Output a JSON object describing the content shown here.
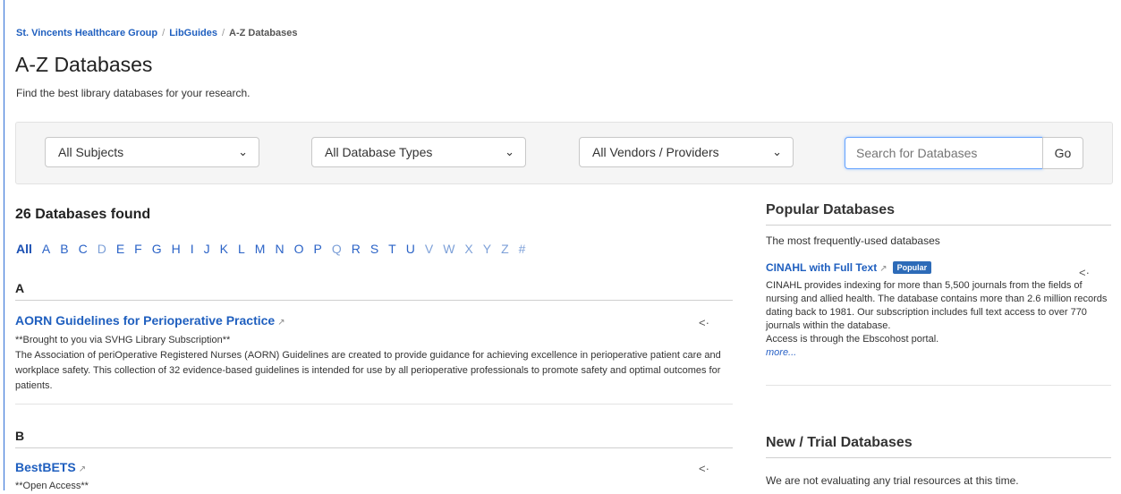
{
  "breadcrumb": {
    "org": "St. Vincents Healthcare Group",
    "libguides": "LibGuides",
    "current": "A-Z Databases",
    "separator": "/"
  },
  "page": {
    "title": "A-Z Databases",
    "subtitle": "Find the best library databases for your research."
  },
  "filters": {
    "subjects": "All Subjects",
    "types": "All Database Types",
    "vendors": "All Vendors / Providers",
    "search_placeholder": "Search for Databases",
    "go_label": "Go"
  },
  "results": {
    "found": "26 Databases found",
    "letters": [
      "All",
      "A",
      "B",
      "C",
      "D",
      "E",
      "F",
      "G",
      "H",
      "I",
      "J",
      "K",
      "L",
      "M",
      "N",
      "O",
      "P",
      "Q",
      "R",
      "S",
      "T",
      "U",
      "V",
      "W",
      "X",
      "Y",
      "Z",
      "#"
    ]
  },
  "sections": [
    {
      "letter": "A",
      "title": "AORN Guidelines for Perioperative Practice",
      "line1": "**Brought to you via SVHG Library Subscription**",
      "line2": "The Association of periOperative Registered Nurses (AORN) Guidelines are created to provide guidance for achieving excellence in perioperative patient care and workplace safety. This collection of 32 evidence-based guidelines is intended for use by all perioperative professionals to promote safety and optimal outcomes for patients."
    },
    {
      "letter": "B",
      "title": "BestBETS",
      "line1": "**Open Access**"
    }
  ],
  "popular": {
    "heading": "Popular Databases",
    "intro": "The most frequently-used databases",
    "item_title": "CINAHL with Full Text",
    "badge": "Popular",
    "desc": "CINAHL provides indexing for more than 5,500 journals from the fields of nursing and allied health. The database contains more than 2.6 million records dating back to 1981. Our subscription includes full text access to over 770 journals within the database.",
    "access": "Access is through the Ebscohost portal.",
    "more": "more..."
  },
  "trial": {
    "heading": "New / Trial Databases",
    "text": "We are not evaluating any trial resources at this time."
  },
  "icons": {
    "external": "external-link-icon",
    "share": "share-icon",
    "chevron": "chevron-down-icon"
  },
  "colors": {
    "link": "#1f5fbf",
    "badge": "#2d6bb8",
    "focus": "#66a3ff"
  }
}
